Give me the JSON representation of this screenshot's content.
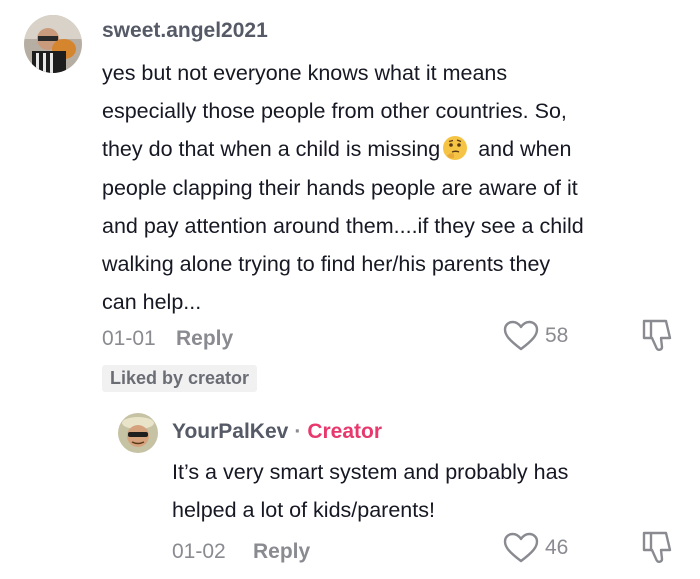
{
  "comment1": {
    "username": "sweet.angel2021",
    "avatar_icon": "user-avatar",
    "lines": [
      "yes but not everyone knows what it means",
      "especially those people from other countries. So,",
      "they do that when a child is missing",
      "and when",
      "people clapping their hands people are aware of it",
      "and pay attention around them....if they see a child",
      "walking alone trying to find her/his parents they",
      "can help..."
    ],
    "emoji": "thinking-face-emoji",
    "date": "01-01",
    "reply_label": "Reply",
    "likes": "58",
    "liked_badge": "Liked by creator"
  },
  "comment2": {
    "username": "YourPalKev",
    "separator": "·",
    "creator_label": "Creator",
    "avatar_icon": "creator-avatar",
    "lines": [
      "It’s a very smart system and probably has",
      "helped a lot of kids/parents!"
    ],
    "date": "01-02",
    "reply_label": "Reply",
    "likes": "46"
  },
  "colors": {
    "primary_text": "#161823",
    "secondary_text": "#8a8b91",
    "creator_accent": "#e8396e",
    "badge_bg": "#f1f1f2"
  }
}
